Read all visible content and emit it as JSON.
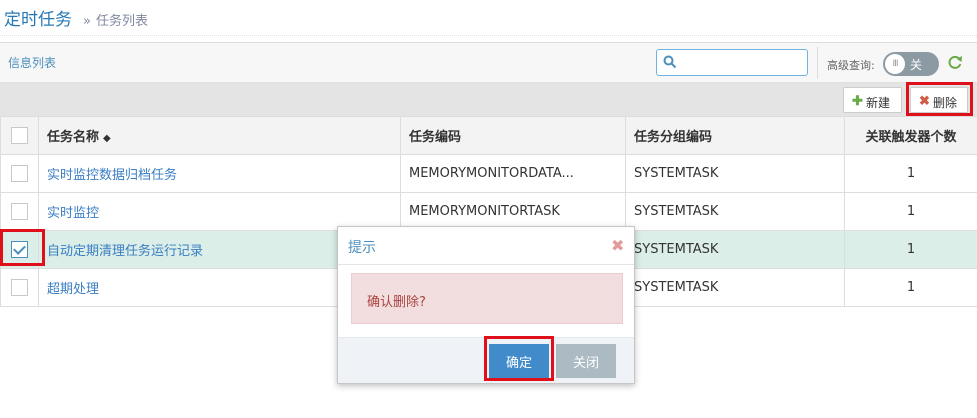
{
  "header": {
    "title": "定时任务",
    "breadcrumb_sep": "»",
    "breadcrumb": "任务列表"
  },
  "panel": {
    "title": "信息列表",
    "search": {
      "value": "",
      "placeholder": ""
    },
    "advanced_label": "高级查询:",
    "toggle": {
      "knob": "III",
      "label": "关",
      "state": "off"
    }
  },
  "toolbar": {
    "new_label": "新建",
    "delete_label": "删除",
    "new_icon": "plus-icon",
    "delete_icon": "x-icon"
  },
  "table": {
    "columns": [
      "任务名称",
      "任务编码",
      "任务分组编码",
      "关联触发器个数"
    ],
    "rows": [
      {
        "checked": false,
        "name": "实时监控数据归档任务",
        "code": "MEMORYMONITORDATA...",
        "group": "SYSTEMTASK",
        "count": "1"
      },
      {
        "checked": false,
        "name": "实时监控",
        "code": "MEMORYMONITORTASK",
        "group": "SYSTEMTASK",
        "count": "1"
      },
      {
        "checked": true,
        "name": "自动定期清理任务运行记录",
        "code": "",
        "group": "SYSTEMTASK",
        "count": "1"
      },
      {
        "checked": false,
        "name": "超期处理",
        "code": "",
        "group": "SYSTEMTASK",
        "count": "1"
      }
    ]
  },
  "modal": {
    "title": "提示",
    "message": "确认删除?",
    "ok_label": "确定",
    "close_label": "关闭"
  },
  "colors": {
    "accent": "#4c8fbd",
    "highlight": "#e0101a",
    "selected_row": "#dbeee8",
    "primary_button": "#428bca"
  }
}
